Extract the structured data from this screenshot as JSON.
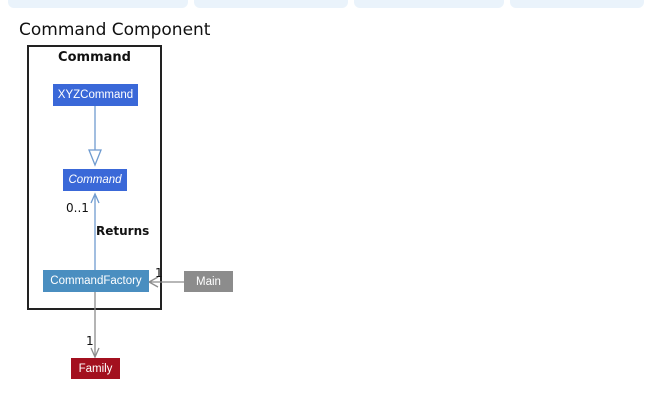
{
  "diagram": {
    "title": "Command Component",
    "package": {
      "label": "Command"
    },
    "nodes": {
      "xyz_command": {
        "label": "XYZCommand",
        "color": "#3a68d8"
      },
      "command": {
        "label": "Command",
        "color": "#3a68d8",
        "abstract": true
      },
      "command_factory": {
        "label": "CommandFactory",
        "color": "#4a8ec0"
      },
      "main": {
        "label": "Main",
        "color": "#8c8c8c"
      },
      "family": {
        "label": "Family",
        "color": "#a3101f"
      }
    },
    "edges": {
      "factory_to_command": {
        "label": "Returns",
        "multiplicity": "0..1"
      },
      "main_to_factory": {
        "multiplicity": "1"
      },
      "factory_to_family": {
        "multiplicity": "1"
      }
    }
  }
}
